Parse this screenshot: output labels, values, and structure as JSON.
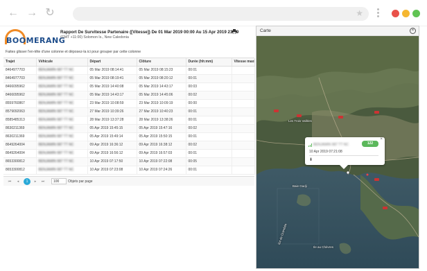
{
  "browser": {
    "icons": [
      "back-icon",
      "forward-icon",
      "reload-icon",
      "star-icon",
      "menu-icon"
    ],
    "dots": [
      "#e9524a",
      "#f5b731",
      "#61c454"
    ]
  },
  "report": {
    "title": "Rapport De Survitesse Partenaire ([Vitesse]) De 01 Mar 2019 00:00 Au 15 Apr 2019 23:59",
    "subtitle": "(GMT +11:00) Solomon Is., New Caledonia",
    "group_hint": "Faites glisser l'en-tête d'une colonne et déposez-la ici pour grouper par cette colonne",
    "logo": "BOOMERANG"
  },
  "grid": {
    "columns": [
      "Trajet",
      "Véhicule",
      "Départ",
      "Clôture",
      "Durée (hh:mm)",
      "Vitesse maxi"
    ],
    "rows": [
      [
        "8464977703",
        "BENJAMIN 987 TT NC",
        "05 Mar 2019 08:14:41",
        "05 Mar 2019 08:15:23",
        "00:01",
        ""
      ],
      [
        "8464977703",
        "BENJAMIN 987 TT NC",
        "05 Mar 2019 08:19:41",
        "05 Mar 2019 08:20:12",
        "00:01",
        ""
      ],
      [
        "8466095962",
        "BENJAMIN 987 TT NC",
        "05 Mar 2019 14:40:08",
        "05 Mar 2019 14:43:17",
        "00:03",
        ""
      ],
      [
        "8466095962",
        "BENJAMIN 987 TT NC",
        "05 Mar 2019 14:43:17",
        "05 Mar 2019 14:45:06",
        "00:02",
        ""
      ],
      [
        "8559760867",
        "BENJAMIN 987 TT NC",
        "23 Mar 2019 10:08:59",
        "23 Mar 2019 10:09:19",
        "00:00",
        ""
      ],
      [
        "8579092063",
        "BENJAMIN 987 TT NC",
        "27 Mar 2019 10:39:26",
        "27 Mar 2019 10:40:23",
        "00:01",
        ""
      ],
      [
        "8585485313",
        "BENJAMIN 987 TT NC",
        "28 Mar 2019 13:37:28",
        "28 Mar 2019 13:38:26",
        "00:01",
        ""
      ],
      [
        "8630211369",
        "BENJAMIN 987 TT NC",
        "05 Apr 2019 15:45:15",
        "05 Apr 2019 15:47:16",
        "00:02",
        ""
      ],
      [
        "8630211369",
        "BENJAMIN 987 TT NC",
        "05 Apr 2019 15:49:14",
        "05 Apr 2019 15:50:15",
        "00:01",
        ""
      ],
      [
        "8649264004",
        "BENJAMIN 987 TT NC",
        "09 Apr 2019 16:36:12",
        "09 Apr 2019 16:38:12",
        "00:02",
        ""
      ],
      [
        "8649264004",
        "BENJAMIN 987 TT NC",
        "09 Apr 2019 16:56:12",
        "09 Apr 2019 16:57:03",
        "00:01",
        ""
      ],
      [
        "8653300812",
        "BENJAMIN 987 TT NC",
        "10 Apr 2019 07:17:50",
        "10 Apr 2019 07:22:08",
        "00:05",
        ""
      ],
      [
        "8653300812",
        "BENJAMIN 987 TT NC",
        "10 Apr 2019 07:23:08",
        "10 Apr 2019 07:24:26",
        "00:01",
        ""
      ]
    ]
  },
  "pager": {
    "first": "⏮",
    "prev": "◂",
    "current": "1",
    "next": "▸",
    "last": "⏭",
    "page_size": "100",
    "page_size_label": "Objets par page"
  },
  "map": {
    "title": "Carte",
    "labels": {
      "city": "Les Trois Vallées",
      "bay": "Baie Gadji",
      "reef": "Ilot de Ouindala",
      "lagoon": "Ile au Chèvres"
    },
    "popup": {
      "vehicle": "BENJAMIN 987 TT NC",
      "speed": "122",
      "date": "10 Apr 2019 07:21:08"
    }
  }
}
